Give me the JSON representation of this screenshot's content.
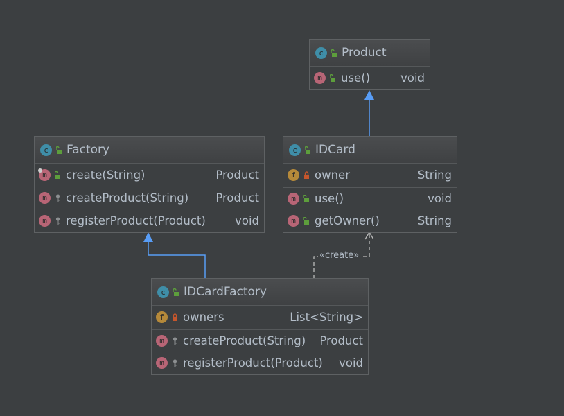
{
  "colors": {
    "background": "#3c3f41",
    "generalization": "#589df6",
    "dependency": "#bbbbbb",
    "text": "#b3bdc8"
  },
  "classes": [
    {
      "id": "product",
      "name": "Product",
      "kind_icon": "class-icon",
      "visibility": "public",
      "members": [
        {
          "kind": "method",
          "visibility": "public",
          "name": "use()",
          "type": "void"
        }
      ]
    },
    {
      "id": "factory",
      "name": "Factory",
      "kind_icon": "abstract-class-icon",
      "visibility": "public",
      "members": [
        {
          "kind": "method",
          "visibility": "public",
          "name": "create(String)",
          "type": "Product",
          "final": true
        },
        {
          "kind": "method",
          "visibility": "protected",
          "name": "createProduct(String)",
          "type": "Product"
        },
        {
          "kind": "method",
          "visibility": "protected",
          "name": "registerProduct(Product)",
          "type": "void"
        }
      ]
    },
    {
      "id": "idcard",
      "name": "IDCard",
      "kind_icon": "class-icon",
      "visibility": "public",
      "members": [
        {
          "kind": "field",
          "visibility": "private",
          "name": "owner",
          "type": "String"
        },
        {
          "kind": "method",
          "visibility": "public",
          "name": "use()",
          "type": "void"
        },
        {
          "kind": "method",
          "visibility": "public",
          "name": "getOwner()",
          "type": "String"
        }
      ]
    },
    {
      "id": "idcardfactory",
      "name": "IDCardFactory",
      "kind_icon": "class-icon",
      "visibility": "public",
      "members": [
        {
          "kind": "field",
          "visibility": "private",
          "name": "owners",
          "type": "List<String>"
        },
        {
          "kind": "method",
          "visibility": "protected",
          "name": "createProduct(String)",
          "type": "Product"
        },
        {
          "kind": "method",
          "visibility": "protected",
          "name": "registerProduct(Product)",
          "type": "void"
        }
      ]
    }
  ],
  "relations": [
    {
      "type": "generalization",
      "from": "IDCard",
      "to": "Product"
    },
    {
      "type": "generalization",
      "from": "IDCardFactory",
      "to": "Factory"
    },
    {
      "type": "dependency",
      "from": "IDCardFactory",
      "to": "IDCard",
      "label": "«create»"
    }
  ]
}
